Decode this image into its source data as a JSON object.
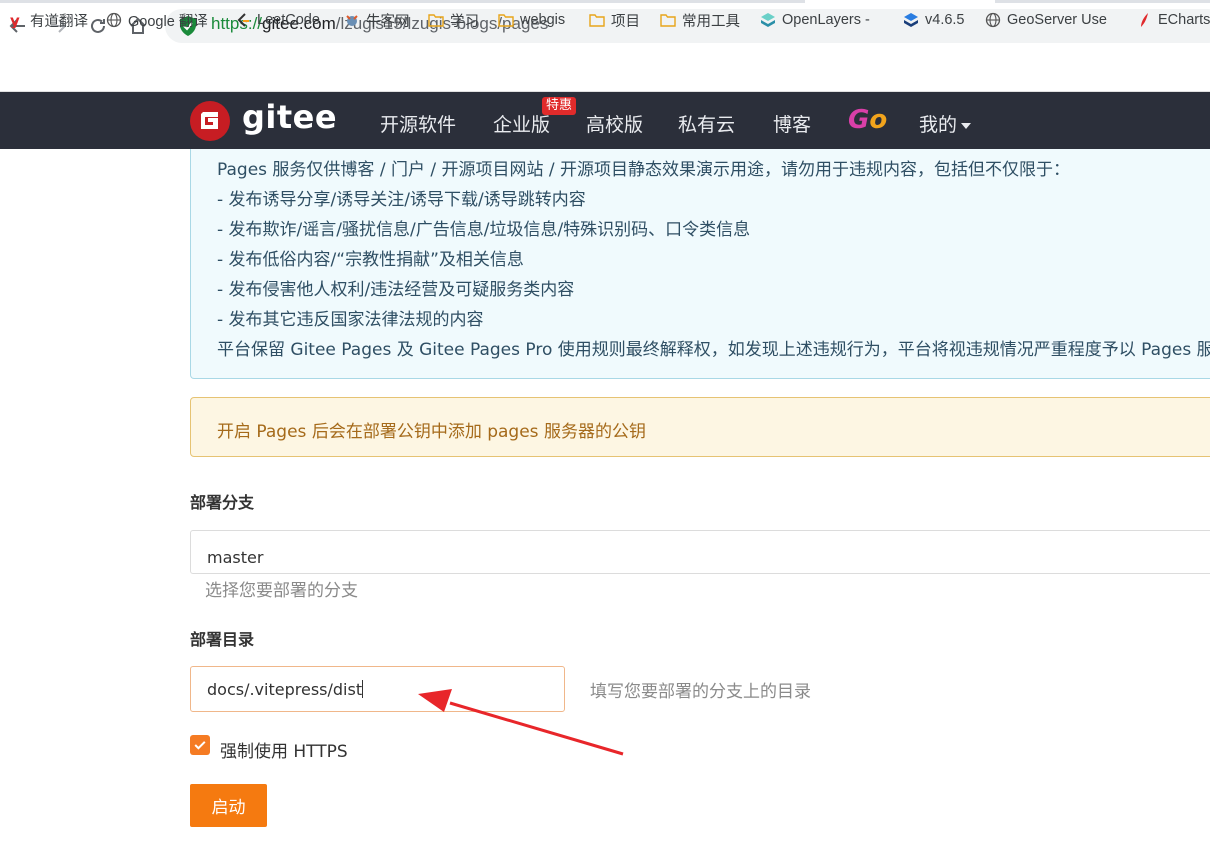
{
  "browser": {
    "url_scheme": "https://",
    "url_host": "gitee.com",
    "url_path": "/lzugis15/lzugis-blogs/pages",
    "bookmarks": [
      {
        "label": "有道翻译",
        "icon": "youdao-icon"
      },
      {
        "label": "Google 翻译",
        "icon": "globe-icon"
      },
      {
        "label": "LeetCode",
        "icon": "leetcode-icon"
      },
      {
        "label": "牛客网",
        "icon": "nowcoder-icon"
      },
      {
        "label": "学习",
        "icon": "folder-icon"
      },
      {
        "label": "webgis",
        "icon": "folder-icon"
      },
      {
        "label": "项目",
        "icon": "folder-icon"
      },
      {
        "label": "常用工具",
        "icon": "folder-icon"
      },
      {
        "label": "OpenLayers -",
        "icon": "openlayers-icon"
      },
      {
        "label": "v4.6.5",
        "icon": "layers-icon"
      },
      {
        "label": "GeoServer Use",
        "icon": "globe-icon"
      },
      {
        "label": "ECharts",
        "icon": "echarts-icon"
      }
    ]
  },
  "header": {
    "logo_text": "gitee",
    "nav": [
      "开源软件",
      "企业版",
      "高校版",
      "私有云",
      "博客"
    ],
    "badge": "特惠",
    "go_logo": [
      "G",
      "o"
    ],
    "my_label": "我的"
  },
  "notice": {
    "lines": [
      "Pages 服务仅供博客 / 门户 / 开源项目网站 / 开源项目静态效果演示用途，请勿用于违规内容，包括但不仅限于：",
      "- 发布诱导分享/诱导关注/诱导下载/诱导跳转内容",
      "- 发布欺诈/谣言/骚扰信息/广告信息/垃圾信息/特殊识别码、口令类信息",
      "- 发布低俗内容/“宗教性捐献”及相关信息",
      "- 发布侵害他人权利/违法经营及可疑服务类内容",
      "- 发布其它违反国家法律法规的内容",
      "平台保留 Gitee Pages 及 Gitee Pages Pro 使用规则最终解释权，如发现上述违规行为，平台将视违规情况严重程度予以 Pages 服务"
    ],
    "warning": "开启 Pages 后会在部署公钥中添加 pages 服务器的公钥"
  },
  "form": {
    "branch_label": "部署分支",
    "branch_value": "master",
    "branch_hint": "选择您要部署的分支",
    "dir_label": "部署目录",
    "dir_value": "docs/.vitepress/dist",
    "dir_hint": "填写您要部署的分支上的目录",
    "https_label": "强制使用 HTTPS",
    "https_checked": true,
    "start_label": "启动"
  },
  "colors": {
    "header_bg": "#2b2f3a",
    "brand_red": "#c71d23",
    "accent_orange": "#f57a10",
    "annotation_arrow": "#e8262a"
  }
}
